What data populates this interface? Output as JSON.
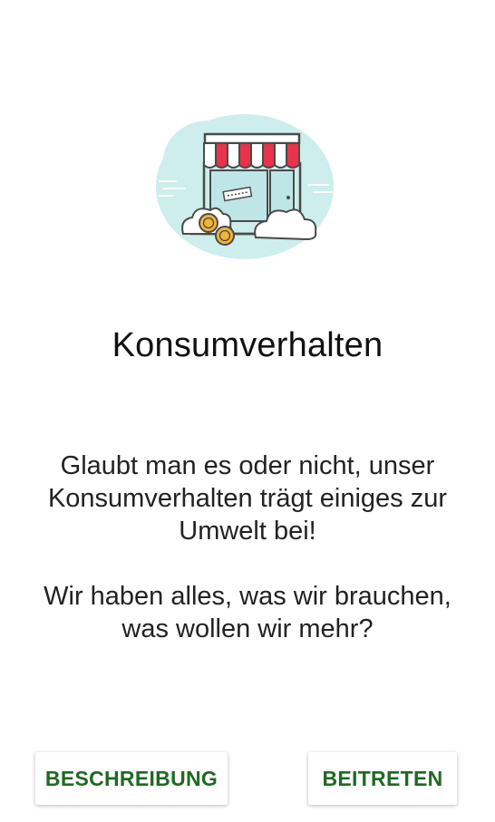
{
  "screen": {
    "title": "Konsumverhalten",
    "description_p1": "Glaubt man es oder nicht, unser Konsumverhalten trägt einiges zur Umwelt bei!",
    "description_p2": "Wir haben alles, was wir brauchen, was wollen wir mehr?",
    "illustration_icon": "storefront-with-coins-icon"
  },
  "actions": {
    "left_label": "BESCHREIBUNG",
    "right_label": "BEITRETEN"
  },
  "colors": {
    "background": "#ffffff",
    "button_text": "#1e6a21",
    "cloud_bg": "#cdeeed",
    "awning_red": "#e8334a",
    "coin_gold": "#f2b53a"
  }
}
